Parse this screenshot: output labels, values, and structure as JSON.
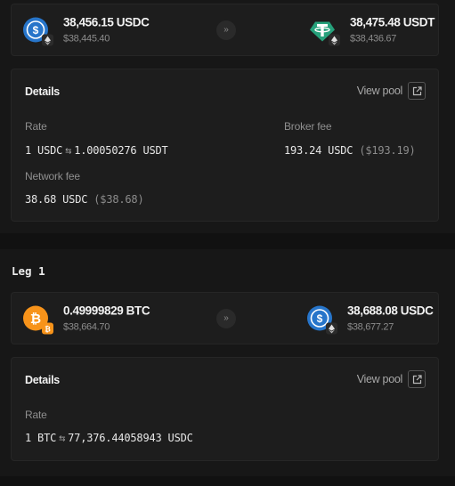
{
  "swap1": {
    "from": {
      "amount": "38,456.15 USDC",
      "usd": "$38,445.40",
      "token": "USDC"
    },
    "to": {
      "amount": "38,475.48 USDT",
      "usd": "$38,436.67",
      "token": "USDT"
    },
    "arrow": "»"
  },
  "details1": {
    "title": "Details",
    "view_pool": "View pool",
    "rate_label": "Rate",
    "rate_from": "1 USDC",
    "rate_swap": "⇆",
    "rate_to": "1.00050276 USDT",
    "broker_fee_label": "Broker fee",
    "broker_fee_value": "193.24 USDC",
    "broker_fee_usd": "($193.19)",
    "network_fee_label": "Network fee",
    "network_fee_value": "38.68 USDC",
    "network_fee_usd": "($38.68)"
  },
  "leg": {
    "title": "Leg 1"
  },
  "swap2": {
    "from": {
      "amount": "0.49999829 BTC",
      "usd": "$38,664.70",
      "token": "BTC"
    },
    "to": {
      "amount": "38,688.08 USDC",
      "usd": "$38,677.27",
      "token": "USDC"
    },
    "arrow": "»"
  },
  "details2": {
    "title": "Details",
    "view_pool": "View pool",
    "rate_label": "Rate",
    "rate_from": "1 BTC",
    "rate_swap": "⇆",
    "rate_to": "77,376.44058943 USDC"
  },
  "colors": {
    "usdc": "#2775ca",
    "usdt": "#26a17b",
    "btc": "#f7931a",
    "eth_badge": "#e0e0e0"
  },
  "icons": [
    "usdc-icon",
    "usdt-icon",
    "btc-icon",
    "ethereum-badge-icon",
    "bitcoin-badge-icon",
    "external-link-icon",
    "chevron-double-right-icon"
  ]
}
